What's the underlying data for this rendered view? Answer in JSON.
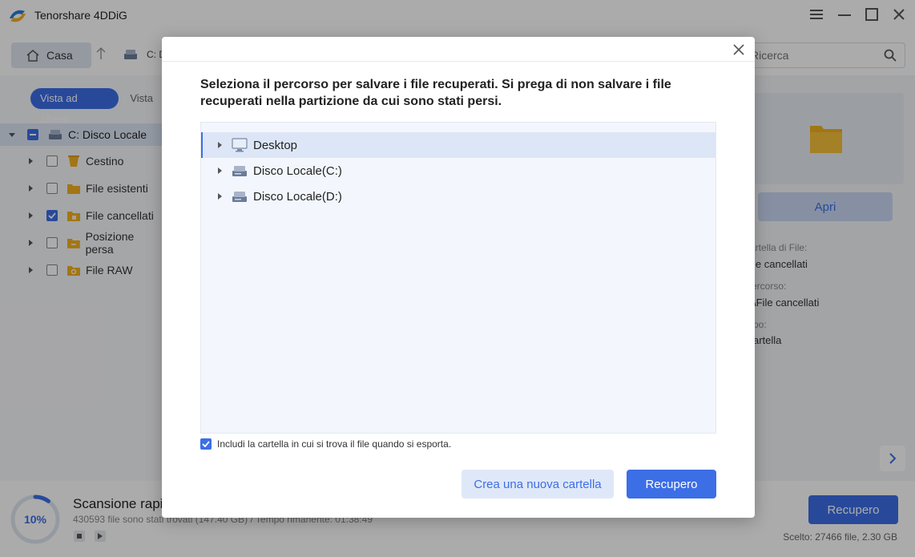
{
  "app": {
    "title": "Tenorshare 4DDiG"
  },
  "window_controls": {
    "menu_icon": "hamburger-icon",
    "minimize_icon": "minimize-icon",
    "maximize_icon": "maximize-icon",
    "close_icon": "close-icon"
  },
  "toolbar": {
    "home_label": "Casa",
    "drive_crumb": "C: D",
    "search_placeholder": "Ricerca"
  },
  "sidebar": {
    "tabs": [
      {
        "label": "Vista ad albero",
        "active": true
      },
      {
        "label": "Vista"
      }
    ],
    "root": {
      "label": "C: Disco Locale"
    },
    "items": [
      {
        "label": "Cestino",
        "checked": false
      },
      {
        "label": "File esistenti",
        "checked": false
      },
      {
        "label": "File cancellati",
        "checked": true
      },
      {
        "label": "Posizione persa",
        "checked": false
      },
      {
        "label": "File RAW",
        "checked": false
      }
    ]
  },
  "details": {
    "open_label": "Apri",
    "label_1": "artella di File:",
    "value_1": "le cancellati",
    "label_2": "ercorso:",
    "value_2": "\\File cancellati",
    "label_3": "po:",
    "value_3": "artella"
  },
  "footer": {
    "progress_percent_label": "10%",
    "progress_value": 0.1,
    "scan_title": "Scansione rapi",
    "scan_detail": "430593 file sono stati trovati (147.40 GB) /   Tempo rimanente: 01:38:49",
    "recover_label": "Recupero",
    "selected_info": "Scelto: 27466 file, 2.30 GB"
  },
  "dialog": {
    "heading": "Seleziona il percorso per salvare i file recuperati. Si prega di non salvare i file recuperati nella partizione da cui sono stati persi.",
    "folders": [
      {
        "label": "Desktop",
        "icon": "monitor-icon",
        "selected": true
      },
      {
        "label": "Disco Locale(C:)",
        "icon": "drive-icon",
        "selected": false
      },
      {
        "label": "Disco Locale(D:)",
        "icon": "drive-icon",
        "selected": false
      }
    ],
    "include_folder_label": "Includi la cartella in cui si trova il file quando si esporta.",
    "include_folder_checked": true,
    "new_folder_label": "Crea una nuova cartella",
    "recover_label": "Recupero"
  },
  "colors": {
    "accent": "#3c6ee6",
    "folder": "#f2b01e"
  }
}
